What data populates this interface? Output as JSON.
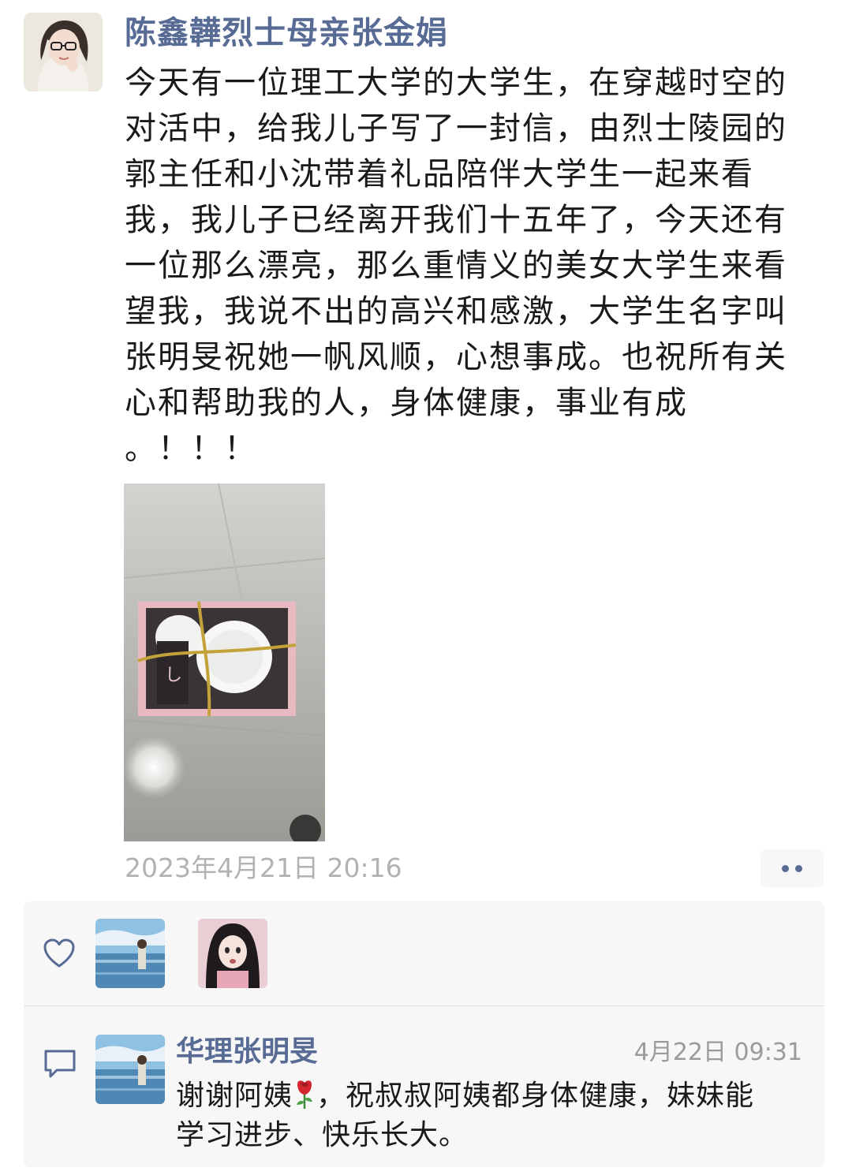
{
  "post": {
    "author": "陈鑫韡烈士母亲张金娟",
    "text": "今天有一位理工大学的大学生，在穿越时空的\n对活中，给我儿子写了一封信，由烈士陵园的\n郭主任和小沈带着礼品陪伴大学生一起来看\n我，我儿子已经离开我们十五年了，今天还有\n一位那么漂亮，那么重情义的美女大学生来看\n望我，我说不出的高兴和感激，大学生名字叫\n张明旻祝她一帆风顺，心想事成。也祝所有关\n心和帮助我的人，身体健康，事业有成\n。！！！",
    "timestamp": "2023年4月21日 20:16",
    "more_icon": "more-dots-icon"
  },
  "interactions": {
    "like_icon": "heart-icon",
    "comment_icon": "comment-icon",
    "comment": {
      "author": "华理张明旻",
      "time": "4月22日 09:31",
      "text_before_emoji": "谢谢阿姨",
      "emoji": "rose",
      "text_after_emoji": "，祝叔叔阿姨都身体健康，妹妹能\n学习进步、快乐长大。"
    }
  },
  "colors": {
    "link_blue": "#576b95",
    "muted_gray": "#b2b2b2",
    "panel_bg": "#f7f7f7"
  }
}
